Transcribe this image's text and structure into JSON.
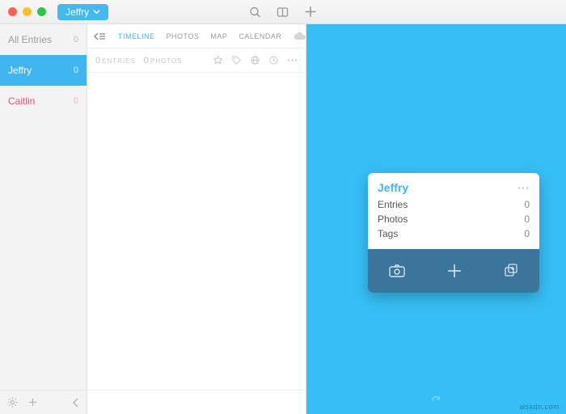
{
  "titlebar": {
    "journal_button": {
      "label": "Jeffry"
    }
  },
  "sidebar": {
    "items": [
      {
        "label": "All Entries",
        "count": "0"
      },
      {
        "label": "Jeffry",
        "count": "0"
      },
      {
        "label": "Caitlin",
        "count": "0"
      }
    ]
  },
  "tabs": {
    "timeline": "TIMELINE",
    "photos": "PHOTOS",
    "map": "MAP",
    "calendar": "CALENDAR"
  },
  "stats": {
    "entries_count": "0",
    "entries_label": "ENTRIES",
    "photos_count": "0",
    "photos_label": "PHOTOS"
  },
  "card": {
    "title": "Jeffry",
    "rows": [
      {
        "label": "Entries",
        "value": "0"
      },
      {
        "label": "Photos",
        "value": "0"
      },
      {
        "label": "Tags",
        "value": "0"
      }
    ]
  },
  "watermark": "wsxdn.com"
}
